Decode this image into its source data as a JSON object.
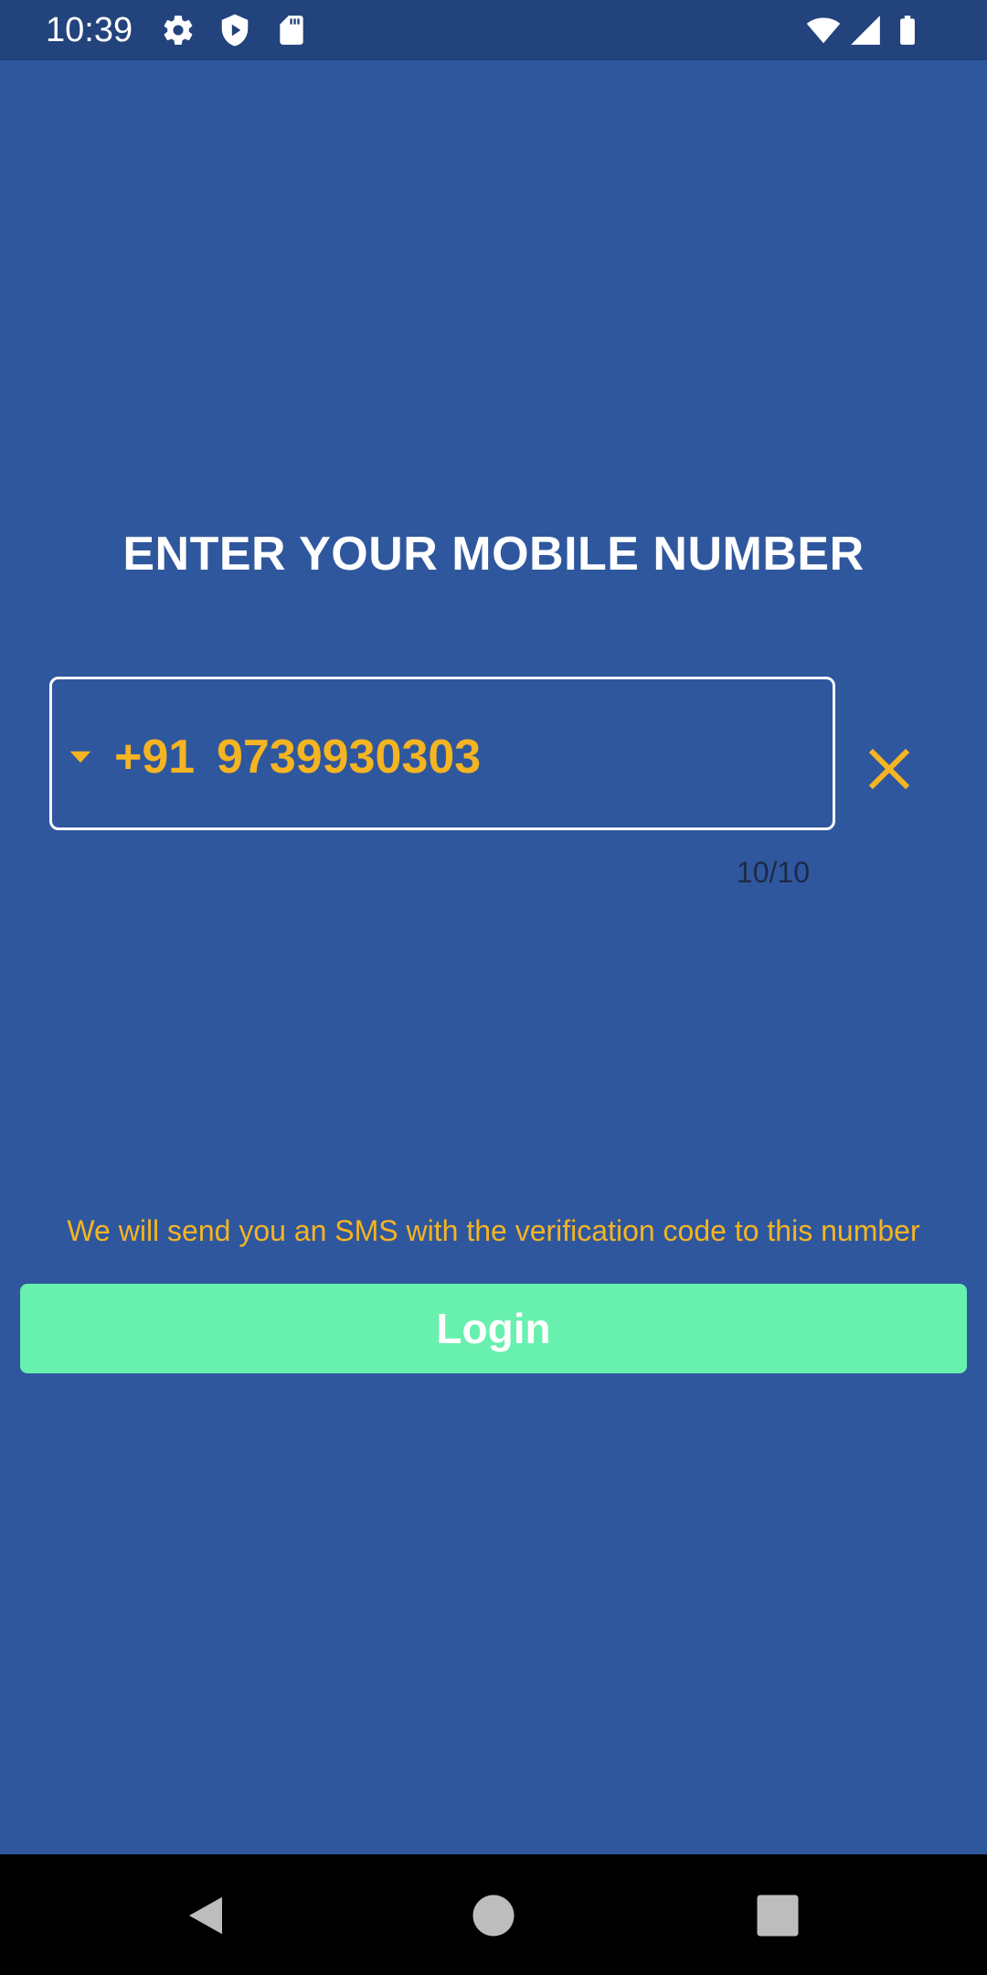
{
  "status_bar": {
    "time": "10:39",
    "left_icons": [
      "gear-icon",
      "shield-play-icon",
      "sd-card-icon"
    ],
    "right_icons": [
      "wifi-icon",
      "signal-icon",
      "battery-icon"
    ]
  },
  "login": {
    "title": "ENTER YOUR MOBILE NUMBER",
    "country_code": "+91",
    "phone_number": "9739930303",
    "char_counter": "10/10",
    "sms_note": "We will send you an SMS with the verification code to this number",
    "login_label": "Login"
  },
  "nav_bar": {
    "buttons": [
      "back-icon",
      "home-icon",
      "recents-icon"
    ]
  },
  "colors": {
    "background": "#2f579e",
    "status_bar": "#22437b",
    "accent": "#f5b421",
    "button": "#68f0ae",
    "nav_bar": "#000000"
  }
}
